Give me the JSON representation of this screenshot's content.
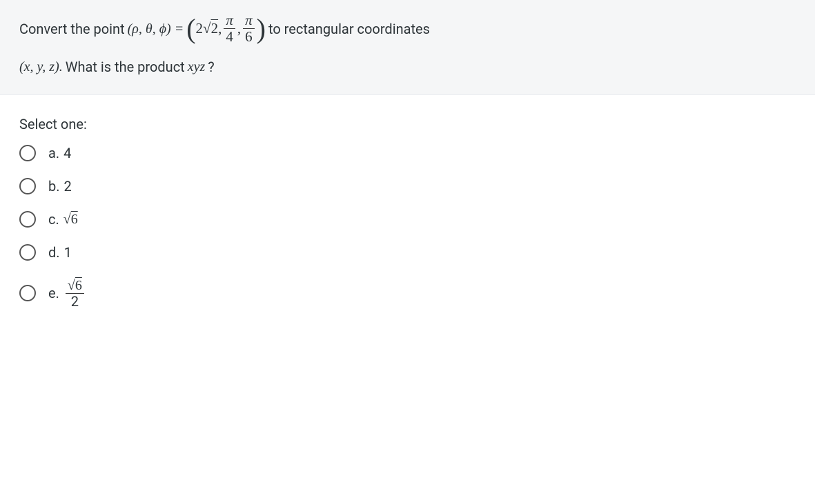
{
  "question": {
    "prefix": "Convert the point ",
    "tuple_left": "(ρ, θ, ϕ) = ",
    "rho_val": "2",
    "sqrt_rho": "2",
    "frac1_num": "π",
    "frac1_den": "4",
    "frac2_num": "π",
    "frac2_den": "6",
    "mid": " to rectangular coordinates ",
    "coords": "(x, y, z).",
    "tail": " What is the product ",
    "prodvar": "xyz",
    "qmark": "?"
  },
  "select_label": "Select one:",
  "options": {
    "a": {
      "letter": "a.",
      "value": "4"
    },
    "b": {
      "letter": "b.",
      "value": "2"
    },
    "c": {
      "letter": "c.",
      "sqrt": "6"
    },
    "d": {
      "letter": "d.",
      "value": "1"
    },
    "e": {
      "letter": "e.",
      "sqrt": "6",
      "den": "2"
    }
  }
}
